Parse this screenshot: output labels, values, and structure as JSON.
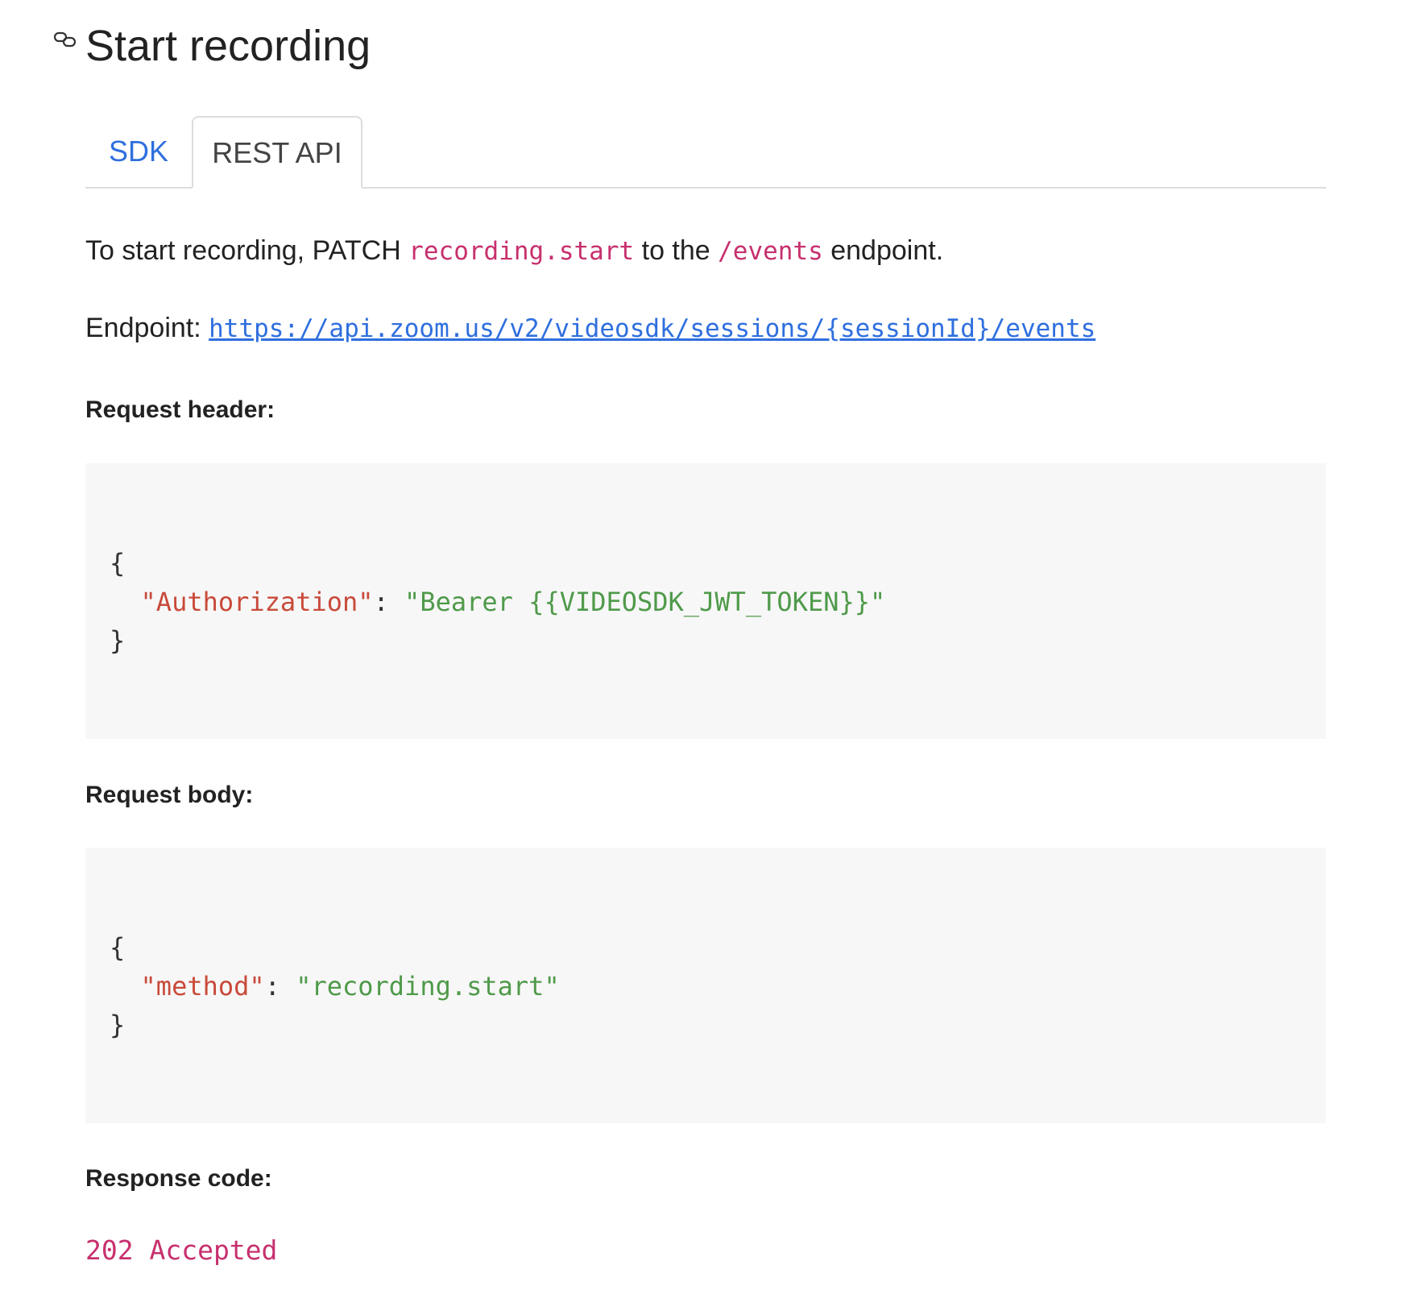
{
  "title": "Start recording",
  "tabs": [
    {
      "label": "SDK",
      "active": false
    },
    {
      "label": "REST API",
      "active": true
    }
  ],
  "intro": {
    "prefix": "To start recording, PATCH ",
    "method_code": "recording.start",
    "middle": " to the ",
    "path_code": "/events",
    "suffix": " endpoint."
  },
  "endpoint": {
    "label": "Endpoint: ",
    "url": "https://api.zoom.us/v2/videosdk/sessions/{sessionId}/events"
  },
  "request_header": {
    "label": "Request header:",
    "open": "{",
    "key": "\"Authorization\"",
    "sep": ": ",
    "value": "\"Bearer {{VIDEOSDK_JWT_TOKEN}}\"",
    "close": "}"
  },
  "request_body": {
    "label": "Request body:",
    "open": "{",
    "key": "\"method\"",
    "sep": ": ",
    "value": "\"recording.start\"",
    "close": "}"
  },
  "response": {
    "label": "Response code:",
    "code": "202 Accepted"
  },
  "colors": {
    "link": "#2f6fde",
    "inline_code": "#c7306e",
    "json_key": "#c94a3a",
    "json_string": "#4f9a4a",
    "code_background": "#f7f7f7"
  },
  "icons": {
    "anchor": "link-icon"
  }
}
